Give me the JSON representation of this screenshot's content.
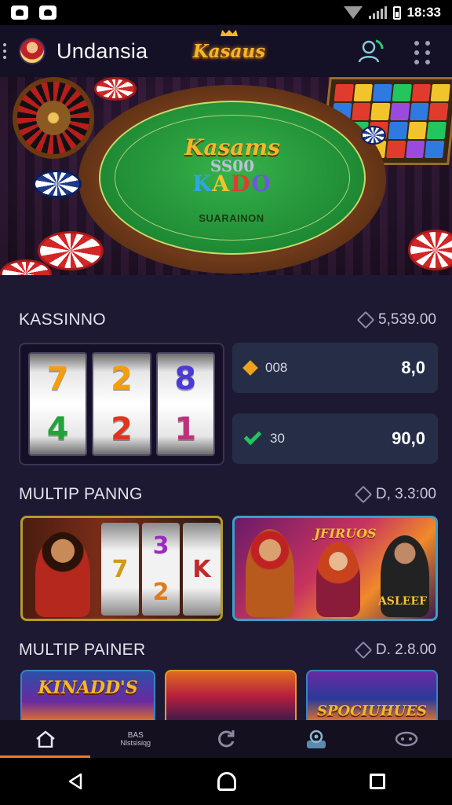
{
  "status_bar": {
    "time": "18:33"
  },
  "header": {
    "title": "Undansia",
    "logo_text": "Kasaus"
  },
  "hero": {
    "line1": "Kasams",
    "line2": "SS00",
    "line3": [
      "K",
      "A",
      "D",
      "O",
      ""
    ],
    "subtitle": "SUARAINON"
  },
  "section1": {
    "title": "KASSINNO",
    "meta": "5,539.00",
    "reels": [
      [
        "7",
        "4"
      ],
      [
        "2",
        "2"
      ],
      [
        "8",
        "1"
      ]
    ],
    "stats": [
      {
        "icon": "heart-icon",
        "label": "008",
        "value": "8,0"
      },
      {
        "icon": "check-icon",
        "label": "30",
        "value": "90,0"
      }
    ]
  },
  "section2": {
    "title": "MULTIP PANNG",
    "meta": "D, 3.3:00",
    "games": [
      {
        "reel_symbols": [
          [
            "7"
          ],
          [
            "3",
            "2"
          ],
          [
            "K"
          ]
        ]
      },
      {
        "caption_top": "JFIRUOS",
        "caption_bottom": "ASLEEF"
      }
    ]
  },
  "section3": {
    "title": "MULTIP PAINER",
    "meta": "D. 2.8.00",
    "tiles": [
      "KINADD'S",
      "",
      "SPOCIUHUES"
    ]
  },
  "tabs": [
    {
      "icon": "home-icon",
      "label": ""
    },
    {
      "icon": "",
      "label": "BAS",
      "label2": "Nlstsisiqg"
    },
    {
      "icon": "refresh-icon",
      "label": ""
    },
    {
      "icon": "support-icon",
      "label": ""
    },
    {
      "icon": "game-icon",
      "label": ""
    }
  ],
  "colors": {
    "accent": "#f07a2a",
    "background": "#1e1932",
    "gold": "#f3b72a"
  }
}
